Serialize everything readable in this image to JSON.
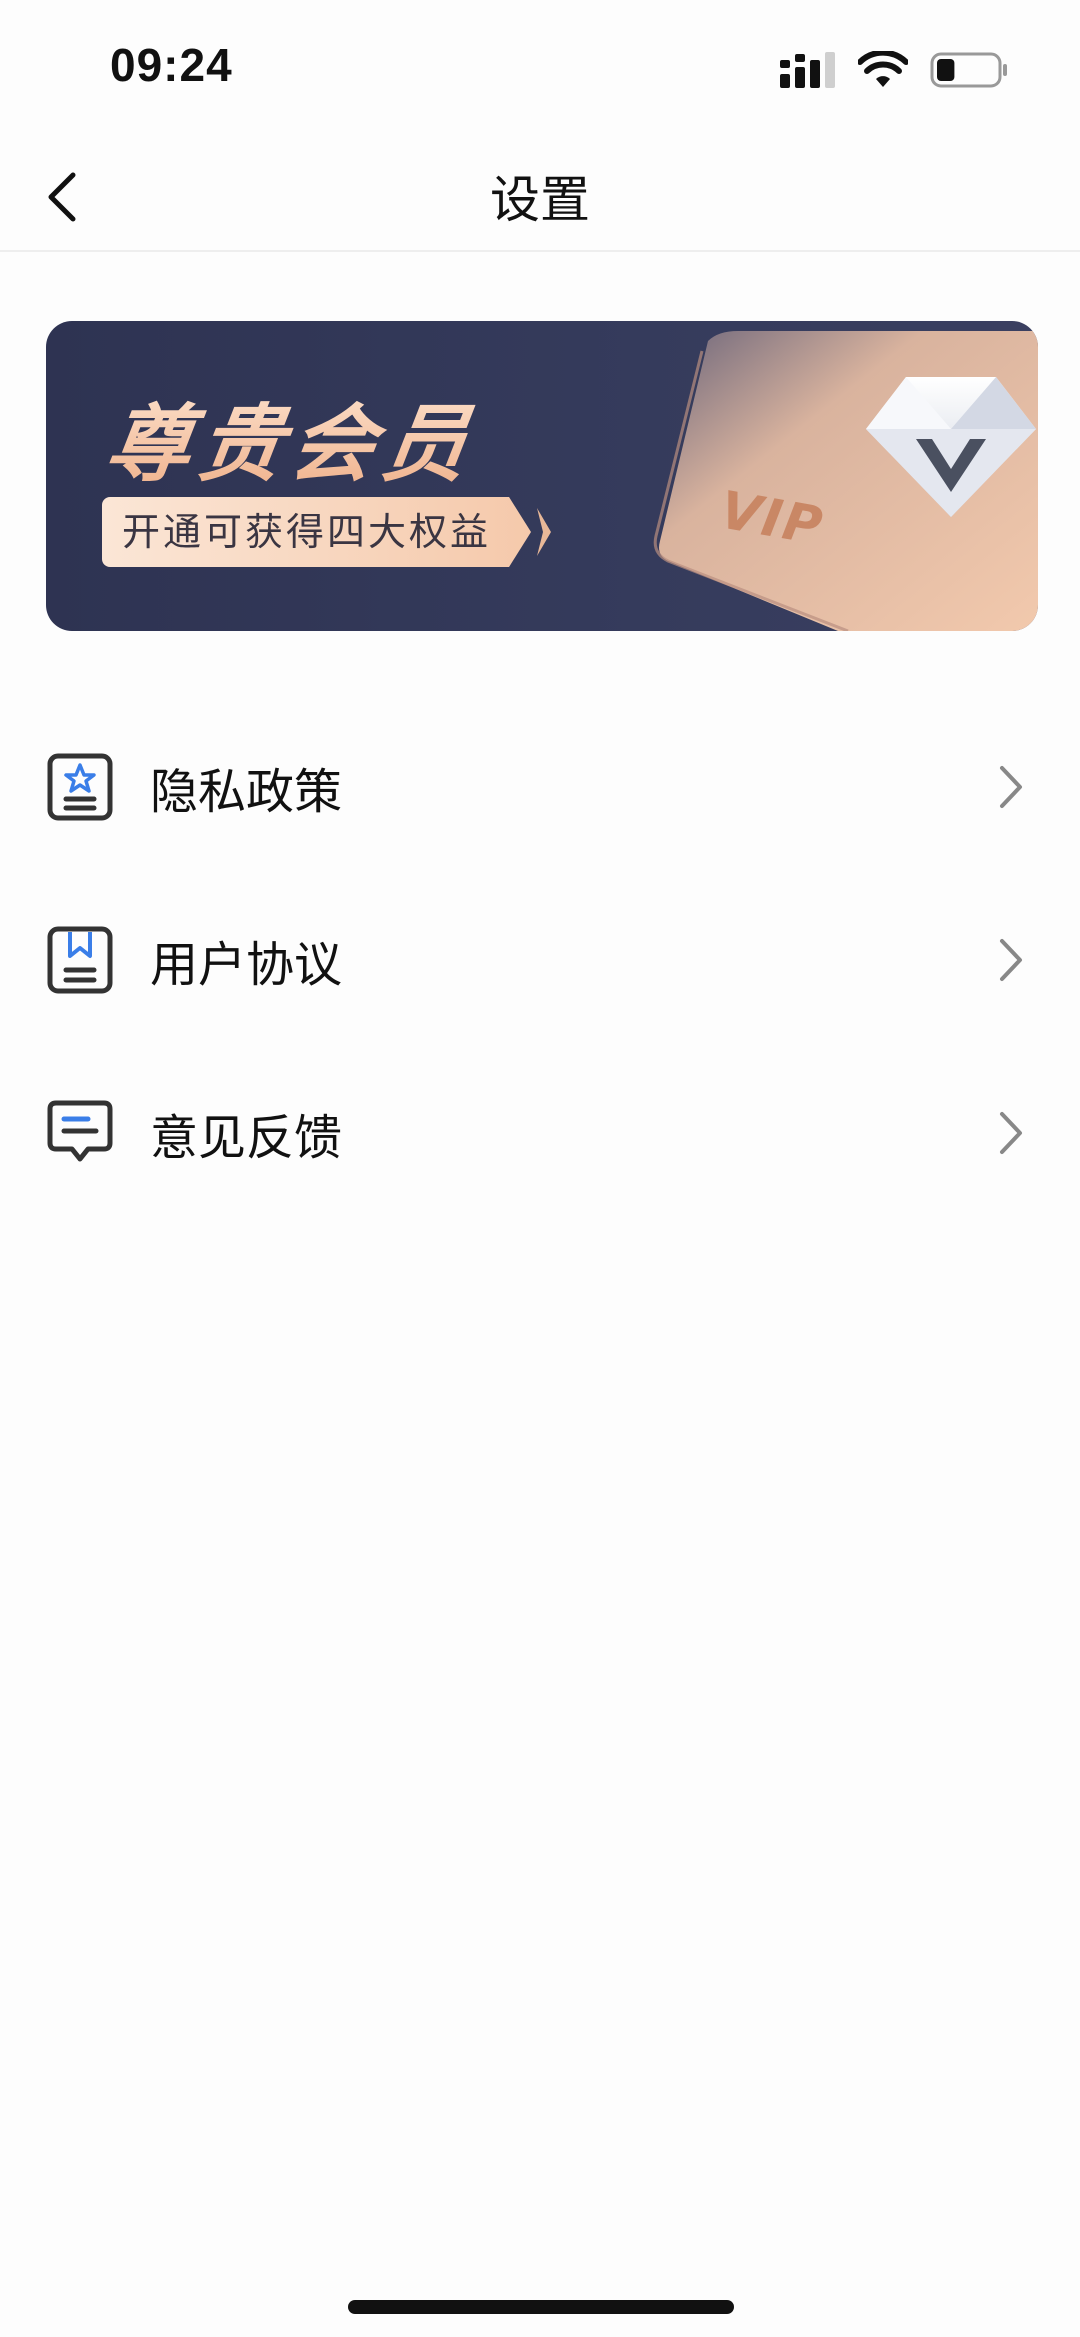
{
  "status_bar": {
    "time": "09:24",
    "icons": [
      "signal-icon",
      "wifi-icon",
      "battery-icon"
    ],
    "battery_level": 0.3
  },
  "nav": {
    "title": "设置",
    "back_icon": "chevron-left-icon"
  },
  "vip_banner": {
    "title": "尊贵会员",
    "subtitle": "开通可获得四大权益",
    "card_label": "VIP",
    "colors": {
      "background": "#30354f",
      "accent": "#f3c7a6"
    }
  },
  "menu": {
    "items": [
      {
        "label": "隐私政策",
        "icon": "privacy-document-icon"
      },
      {
        "label": "用户协议",
        "icon": "agreement-document-icon"
      },
      {
        "label": "意见反馈",
        "icon": "feedback-message-icon"
      }
    ],
    "accent_color": "#3a7ee8"
  }
}
